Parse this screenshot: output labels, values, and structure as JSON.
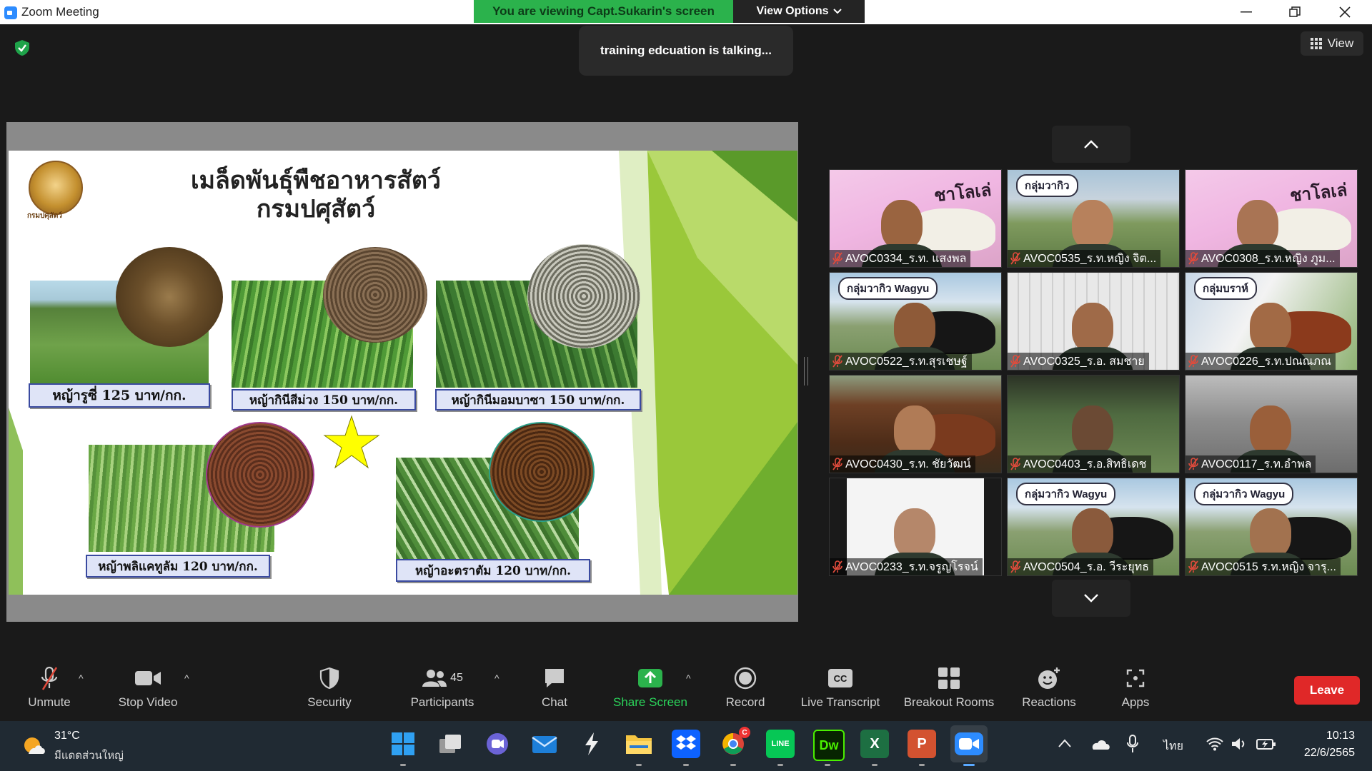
{
  "window": {
    "app_title": "Zoom Meeting"
  },
  "banner": {
    "viewing": "You are viewing Capt.Sukarin's screen",
    "view_options": "View Options"
  },
  "talking": "training edcuation is talking...",
  "view_button": "View",
  "slide": {
    "logo_caption": "กรมปศุสัตว์",
    "title_line1": "เมล็ดพันธุ์พืชอาหารสัตว์",
    "title_line2": "กรมปศุสัตว์",
    "labels": [
      "หญ้ารูซี่  125 บาท/กก.",
      "หญ้ากินีสีม่วง 150 บาท/กก.",
      "หญ้ากินีมอมบาซา 150 บาท/กก.",
      "หญ้าพลิแคทูลัม 120 บาท/กก.",
      "หญ้าอะตราตัม  120 บาท/กก."
    ]
  },
  "participants_gallery": [
    {
      "name": "AVOC0334_ร.ท. แสงพล",
      "bg": "charolais"
    },
    {
      "name": "AVOC0535_ร.ท.หญิง จิต...",
      "bg": "group"
    },
    {
      "name": "AVOC0308_ร.ท.หญิง ภูม...",
      "bg": "charolais"
    },
    {
      "name": "AVOC0522_ร.ท.สุรเชษฐ์",
      "bg": "wagyu"
    },
    {
      "name": "AVOC0325_ร.อ. สมชาย",
      "bg": "blinds"
    },
    {
      "name": "AVOC0226_ร.ท.ปณณภณ",
      "bg": "brahman"
    },
    {
      "name": "AVOC0430_ร.ท. ชัยวัฒน์",
      "bg": "redcow"
    },
    {
      "name": "AVOC0403_ร.อ.สิทธิเดช",
      "bg": "dark"
    },
    {
      "name": "AVOC0117_ร.ท.อำพล",
      "bg": "shed"
    },
    {
      "name": "AVOC0233_ร.ท.จรูญโรจน์",
      "bg": "white"
    },
    {
      "name": "AVOC0504_ร.อ. วีระยุทธ",
      "bg": "wagyu"
    },
    {
      "name": "AVOC0515 ร.ท.หญิง จารุ...",
      "bg": "wagyu"
    }
  ],
  "tile_signs": {
    "charolais": "ชาโลเล่",
    "group": "กลุ่มวากิว",
    "wagyu": "กลุ่มวากิว Wagyu",
    "brahman": "กลุ่มบราห์"
  },
  "toolbar": {
    "unmute": "Unmute",
    "stop_video": "Stop Video",
    "security": "Security",
    "participants": "Participants",
    "participant_count": "45",
    "chat": "Chat",
    "share_screen": "Share Screen",
    "record": "Record",
    "live_transcript": "Live Transcript",
    "breakout_rooms": "Breakout Rooms",
    "reactions": "Reactions",
    "apps": "Apps",
    "leave": "Leave",
    "cc_glyph": "CC"
  },
  "taskbar": {
    "weather_temp": "31°C",
    "weather_desc": "มีแดดส่วนใหญ่",
    "language": "ไทย",
    "time": "10:13",
    "date": "22/6/2565",
    "apps": [
      "windows-start",
      "task-view",
      "teams-chat",
      "mail",
      "spark",
      "file-explorer",
      "dropbox",
      "chrome",
      "line",
      "dreamweaver",
      "excel",
      "powerpoint",
      "zoom"
    ],
    "chrome_badge": "C",
    "dw_label": "Dw",
    "line_label": "LINE"
  },
  "colors": {
    "accent_green": "#2bb24c",
    "leave_red": "#e02828",
    "muted_red": "#e04b3c"
  }
}
